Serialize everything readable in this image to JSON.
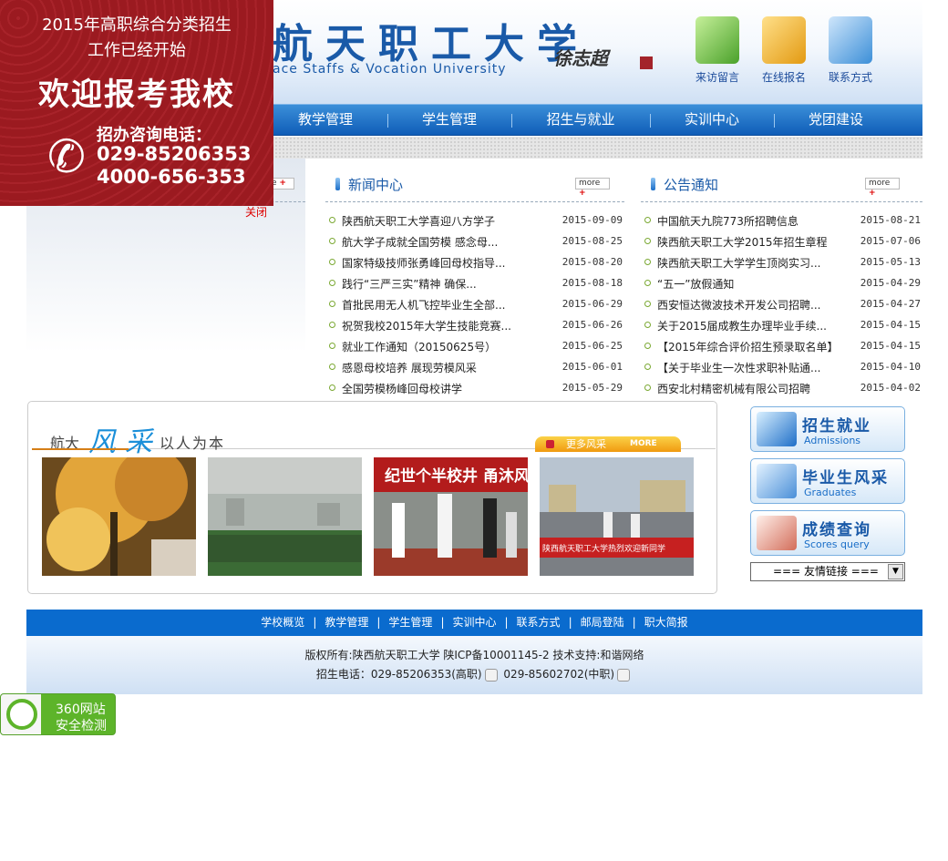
{
  "header": {
    "title_cn": "航天职工大学",
    "title_en": "ace Staffs & Vocation University",
    "signature": "徐志超",
    "icons": [
      {
        "label": "来访留言",
        "icon": "notebook-icon",
        "color": "#6cc13a"
      },
      {
        "label": "在线报名",
        "icon": "folder-globe-icon",
        "color": "#f2b62e"
      },
      {
        "label": "联系方式",
        "icon": "phone-icon",
        "color": "#3c8fd8"
      }
    ]
  },
  "nav": {
    "items": [
      "教学管理",
      "学生管理",
      "招生与就业",
      "实训中心",
      "党团建设"
    ]
  },
  "news": {
    "title": "新闻中心",
    "more": "more",
    "items": [
      {
        "title": "陕西航天职工大学喜迎八方学子",
        "date": "2015-09-09"
      },
      {
        "title": "航大学子成就全国劳模 感念母...",
        "date": "2015-08-25"
      },
      {
        "title": "国家特级技师张勇峰回母校指导...",
        "date": "2015-08-20"
      },
      {
        "title": "践行“三严三实”精神 确保...",
        "date": "2015-08-18"
      },
      {
        "title": "首批民用无人机飞控毕业生全部...",
        "date": "2015-06-29"
      },
      {
        "title": "祝贺我校2015年大学生技能竞赛...",
        "date": "2015-06-26"
      },
      {
        "title": "就业工作通知（20150625号）",
        "date": "2015-06-25"
      },
      {
        "title": "感恩母校培养 展现劳模风采",
        "date": "2015-06-01"
      },
      {
        "title": "全国劳模杨峰回母校讲学",
        "date": "2015-05-29"
      }
    ]
  },
  "notice": {
    "title": "公告通知",
    "more": "more",
    "items": [
      {
        "title": "中国航天九院773所招聘信息",
        "date": "2015-08-21"
      },
      {
        "title": "陕西航天职工大学2015年招生章程",
        "date": "2015-07-06"
      },
      {
        "title": "陕西航天职工大学学生顶岗实习...",
        "date": "2015-05-13"
      },
      {
        "title": "“五一”放假通知",
        "date": "2015-04-29"
      },
      {
        "title": "西安恒达微波技术开发公司招聘...",
        "date": "2015-04-27"
      },
      {
        "title": "关于2015届成教生办理毕业手续...",
        "date": "2015-04-15"
      },
      {
        "title": "【2015年综合评价招生预录取名单】",
        "date": "2015-04-15"
      },
      {
        "title": "【关于毕业生一次性求职补贴通...",
        "date": "2015-04-10"
      },
      {
        "title": "西安北村精密机械有限公司招聘",
        "date": "2015-04-02"
      }
    ]
  },
  "left": {
    "more": "ore",
    "close": "关闭"
  },
  "fengcai": {
    "prefix": "航大",
    "big": "风采",
    "suffix": "以人为本",
    "more": "更多风采",
    "more_en": "MORE",
    "photo_texts": [
      "纪世个半校井 甬沐风",
      "陕西航天职工大学热烈欢迎新同学"
    ]
  },
  "side": {
    "buttons": [
      {
        "cn": "招生就业",
        "en": "Admissions",
        "icon": "monitor-icon"
      },
      {
        "cn": "毕业生风采",
        "en": "Graduates",
        "icon": "graduation-cap-icon"
      },
      {
        "cn": "成绩查询",
        "en": "Scores query",
        "icon": "book-icon"
      }
    ],
    "links_select": "=== 友情链接 ==="
  },
  "footer": {
    "nav": [
      "学校概览",
      "教学管理",
      "学生管理",
      "实训中心",
      "联系方式",
      "邮局登陆",
      "职大简报"
    ],
    "sep": "|",
    "copyright": "版权所有:陕西航天职工大学 陕ICP备10001145-2 技术支持:和谐网络",
    "phone_label": "招生电话：",
    "phone1": "029-85206353(高职)",
    "phone2": "029-85602702(中职)"
  },
  "ad": {
    "line1": "2015年高职综合分类招生",
    "line2": "工作已经开始",
    "line3": "欢迎报考我校",
    "line4": "招办咨询电话：",
    "phone1": "029-85206353",
    "phone2": "4000-656-353"
  },
  "badge": {
    "line1": "360网站",
    "line2": "安全检测"
  }
}
